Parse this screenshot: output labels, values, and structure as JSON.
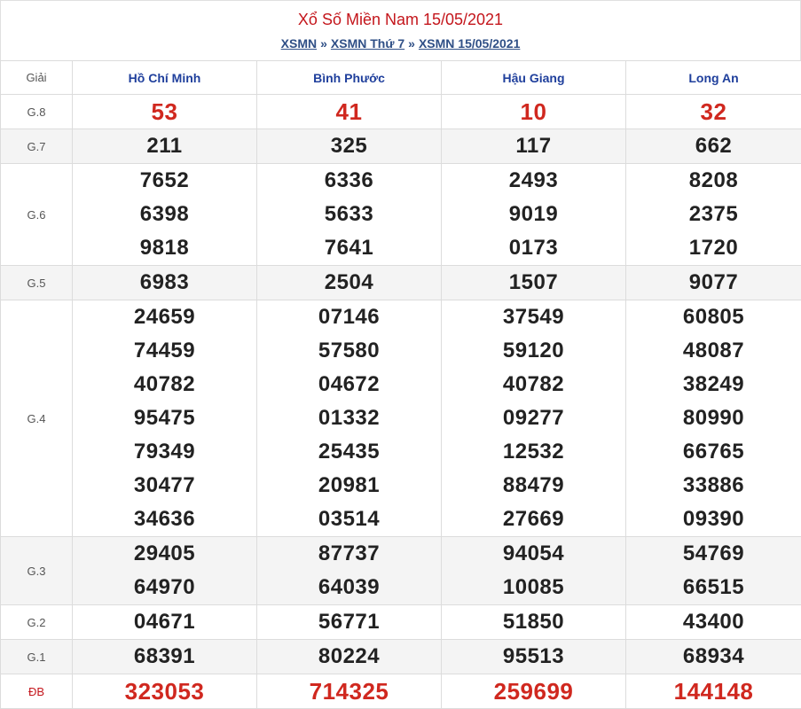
{
  "header": {
    "title": "Xổ Số Miền Nam 15/05/2021",
    "crumbs": [
      "XSMN",
      "XSMN Thứ 7",
      "XSMN 15/05/2021"
    ],
    "separator": "»"
  },
  "table": {
    "label_header": "Giải",
    "provinces": [
      "Hồ Chí Minh",
      "Bình Phước",
      "Hậu Giang",
      "Long An"
    ],
    "rows": [
      {
        "label": "G.8",
        "style": "red",
        "values": [
          [
            "53"
          ],
          [
            "41"
          ],
          [
            "10"
          ],
          [
            "32"
          ]
        ]
      },
      {
        "label": "G.7",
        "style": "normal",
        "values": [
          [
            "211"
          ],
          [
            "325"
          ],
          [
            "117"
          ],
          [
            "662"
          ]
        ]
      },
      {
        "label": "G.6",
        "style": "normal",
        "values": [
          [
            "7652",
            "6398",
            "9818"
          ],
          [
            "6336",
            "5633",
            "7641"
          ],
          [
            "2493",
            "9019",
            "0173"
          ],
          [
            "8208",
            "2375",
            "1720"
          ]
        ]
      },
      {
        "label": "G.5",
        "style": "normal",
        "values": [
          [
            "6983"
          ],
          [
            "2504"
          ],
          [
            "1507"
          ],
          [
            "9077"
          ]
        ]
      },
      {
        "label": "G.4",
        "style": "normal",
        "values": [
          [
            "24659",
            "74459",
            "40782",
            "95475",
            "79349",
            "30477",
            "34636"
          ],
          [
            "07146",
            "57580",
            "04672",
            "01332",
            "25435",
            "20981",
            "03514"
          ],
          [
            "37549",
            "59120",
            "40782",
            "09277",
            "12532",
            "88479",
            "27669"
          ],
          [
            "60805",
            "48087",
            "38249",
            "80990",
            "66765",
            "33886",
            "09390"
          ]
        ]
      },
      {
        "label": "G.3",
        "style": "normal",
        "values": [
          [
            "29405",
            "64970"
          ],
          [
            "87737",
            "64039"
          ],
          [
            "94054",
            "10085"
          ],
          [
            "54769",
            "66515"
          ]
        ]
      },
      {
        "label": "G.2",
        "style": "normal",
        "values": [
          [
            "04671"
          ],
          [
            "56771"
          ],
          [
            "51850"
          ],
          [
            "43400"
          ]
        ]
      },
      {
        "label": "G.1",
        "style": "normal",
        "values": [
          [
            "68391"
          ],
          [
            "80224"
          ],
          [
            "95513"
          ],
          [
            "68934"
          ]
        ]
      },
      {
        "label": "ĐB",
        "style": "db",
        "values": [
          [
            "323053"
          ],
          [
            "714325"
          ],
          [
            "259699"
          ],
          [
            "144148"
          ]
        ]
      }
    ]
  }
}
